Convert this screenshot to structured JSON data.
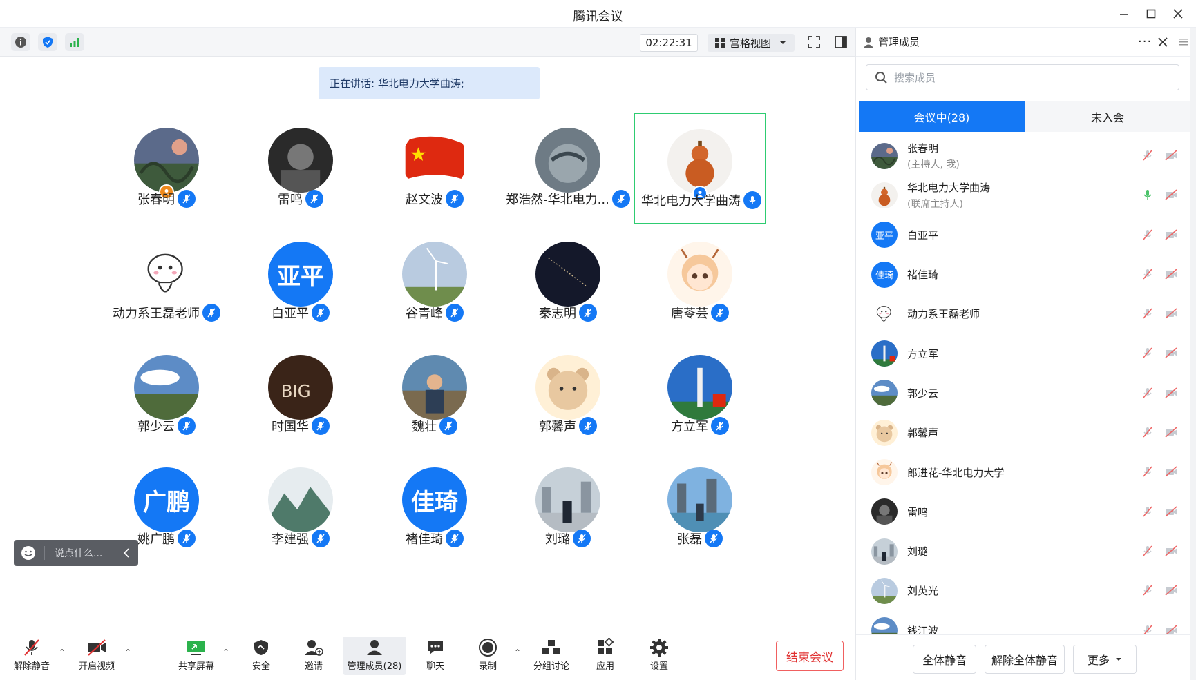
{
  "window": {
    "title": "腾讯会议"
  },
  "toolbar": {
    "timer": "02:22:31",
    "view_mode": "宫格视图"
  },
  "speaking": {
    "text": "正在讲话: 华北电力大学曲涛;"
  },
  "grid": [
    {
      "name": "张春明",
      "avatar": "photo-moon",
      "host": true
    },
    {
      "name": "雷鸣",
      "avatar": "photo-bw"
    },
    {
      "name": "赵文波",
      "avatar": "photo-flag"
    },
    {
      "name": "郑浩然-华北电力...",
      "avatar": "photo-globe"
    },
    {
      "name": "华北电力大学曲涛",
      "avatar": "photo-gourd",
      "speaking": true
    },
    {
      "name": "动力系王磊老师",
      "avatar": "photo-cartoon"
    },
    {
      "name": "白亚平",
      "avatar_text": "亚平"
    },
    {
      "name": "谷青峰",
      "avatar": "photo-wind"
    },
    {
      "name": "秦志明",
      "avatar": "photo-night"
    },
    {
      "name": "唐苓芸",
      "avatar": "photo-girl"
    },
    {
      "name": "郭少云",
      "avatar": "photo-sky"
    },
    {
      "name": "时国华",
      "avatar": "photo-sign"
    },
    {
      "name": "魏壮",
      "avatar": "photo-person"
    },
    {
      "name": "郭馨声",
      "avatar": "photo-bear"
    },
    {
      "name": "方立军",
      "avatar": "photo-tower"
    },
    {
      "name": "姚广鹏",
      "avatar_text": "广鹏"
    },
    {
      "name": "李建强",
      "avatar": "photo-mountain"
    },
    {
      "name": "褚佳琦",
      "avatar_text": "佳琦"
    },
    {
      "name": "刘璐",
      "avatar": "photo-city"
    },
    {
      "name": "张磊",
      "avatar": "photo-city2"
    }
  ],
  "chat": {
    "placeholder": "说点什么..."
  },
  "bottom": {
    "unmute": "解除静音",
    "video": "开启视频",
    "share": "共享屏幕",
    "security": "安全",
    "invite": "邀请",
    "members": "管理成员(28)",
    "chat": "聊天",
    "record": "录制",
    "breakout": "分组讨论",
    "apps": "应用",
    "settings": "设置",
    "end": "结束会议"
  },
  "panel": {
    "title": "管理成员",
    "search_placeholder": "搜索成员",
    "tab_in": "会议中(28)",
    "tab_out": "未入会",
    "members": [
      {
        "name": "张春明",
        "role": "(主持人, 我)",
        "avatar": "photo-moon"
      },
      {
        "name": "华北电力大学曲涛",
        "role": "(联席主持人)",
        "avatar": "photo-gourd",
        "mic_on": true
      },
      {
        "name": "白亚平",
        "avatar_text": "亚平"
      },
      {
        "name": "褚佳琦",
        "avatar_text": "佳琦"
      },
      {
        "name": "动力系王磊老师",
        "avatar": "photo-cartoon"
      },
      {
        "name": "方立军",
        "avatar": "photo-tower"
      },
      {
        "name": "郭少云",
        "avatar": "photo-sky"
      },
      {
        "name": "郭馨声",
        "avatar": "photo-bear"
      },
      {
        "name": "郎进花-华北电力大学",
        "avatar": "photo-girl"
      },
      {
        "name": "雷鸣",
        "avatar": "photo-bw"
      },
      {
        "name": "刘璐",
        "avatar": "photo-city"
      },
      {
        "name": "刘英光",
        "avatar": "photo-wind"
      },
      {
        "name": "钱江波",
        "avatar": "photo-sky"
      }
    ],
    "mute_all": "全体静音",
    "unmute_all": "解除全体静音",
    "more": "更多"
  },
  "colors": {
    "accent": "#1478f5",
    "end": "#e03030",
    "active_border": "#2ecc71"
  }
}
